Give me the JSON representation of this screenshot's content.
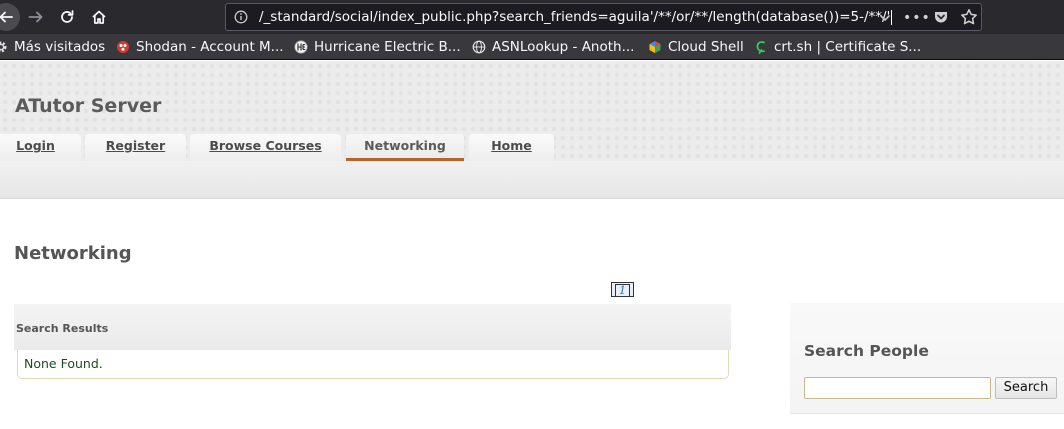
{
  "browser": {
    "url": "/_standard/social/index_public.php?search_friends=aguila'/**/or/**/length(database())=5-/**/'",
    "bookmarks": [
      {
        "label": "Más visitados",
        "icon": "gear-icon"
      },
      {
        "label": "Shodan - Account M...",
        "icon": "shodan-icon"
      },
      {
        "label": "Hurricane Electric B...",
        "icon": "he-logo-icon"
      },
      {
        "label": "ASNLookup - Anoth...",
        "icon": "globe-icon"
      },
      {
        "label": "Cloud Shell",
        "icon": "cloud-shell-icon"
      },
      {
        "label": "crt.sh | Certificate S...",
        "icon": "crt-icon"
      }
    ]
  },
  "site": {
    "title": "ATutor Server",
    "nav": [
      {
        "label": "Login"
      },
      {
        "label": "Register"
      },
      {
        "label": "Browse Courses"
      },
      {
        "label": "Networking",
        "active": true
      },
      {
        "label": "Home"
      }
    ]
  },
  "main": {
    "heading": "Networking",
    "pager": "1",
    "results_title": "Search Results",
    "results_empty": "None Found."
  },
  "sidebar": {
    "title": "Search People",
    "search_value": "",
    "search_button": "Search"
  },
  "colors": {
    "accent": "#b2662a",
    "toolbar": "#2a2a2e",
    "bookmarks_bar": "#38383d",
    "empty_text": "#1d4b24"
  }
}
